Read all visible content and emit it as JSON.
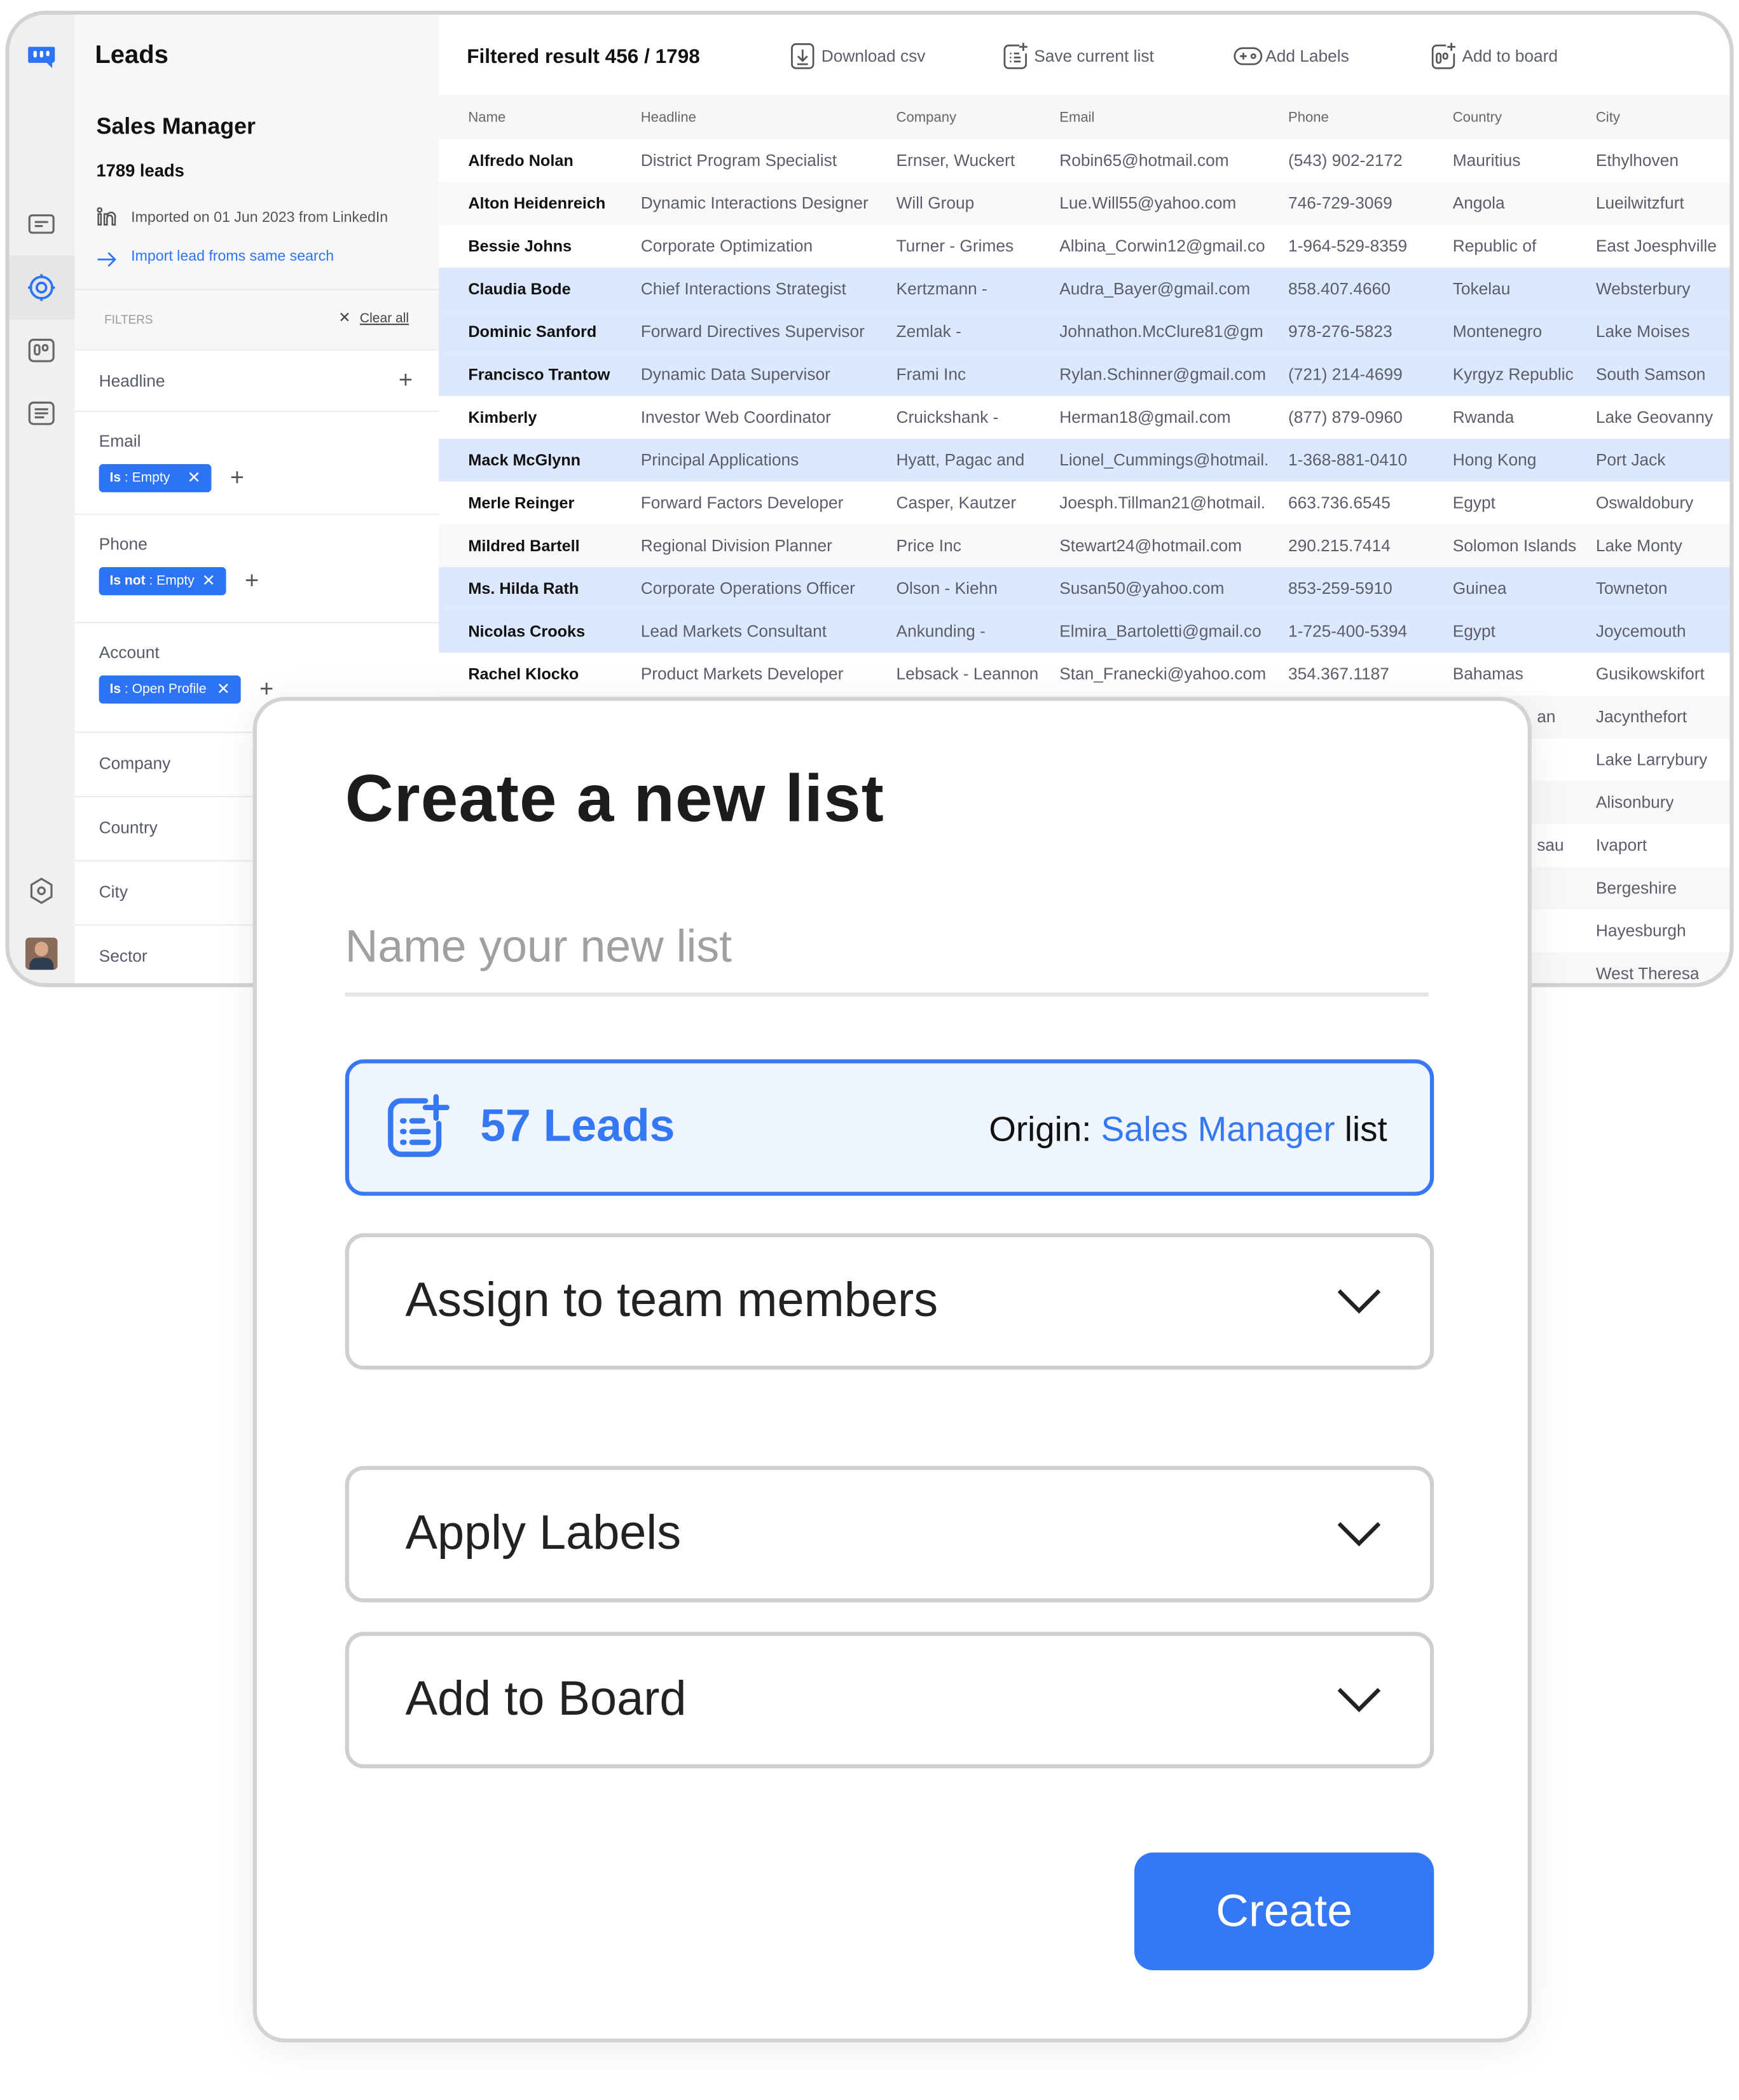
{
  "colors": {
    "accent": "#3578f6",
    "selected_row": "#dce8fd",
    "chip": "#2c74f5"
  },
  "rail": {
    "icons": [
      "logo-icon",
      "chat-icon",
      "target-icon",
      "board-icon",
      "list-icon",
      "settings-icon",
      "avatar"
    ]
  },
  "panel": {
    "title": "Leads",
    "list_name": "Sales Manager",
    "lead_count": "1789 leads",
    "imported": "Imported on 01 Jun 2023 from LinkedIn",
    "import_link": "Import lead froms same search",
    "filters_label": "FILTERS",
    "clear_all": "Clear all",
    "filters": [
      {
        "label": "Headline"
      },
      {
        "label": "Email",
        "chip_op": "Is",
        "chip_val": " : Empty"
      },
      {
        "label": "Phone",
        "chip_op": "Is not",
        "chip_val": " : Empty"
      },
      {
        "label": "Account",
        "chip_op": "Is",
        "chip_val": " : Open Profile"
      },
      {
        "label": "Company"
      },
      {
        "label": "Country"
      },
      {
        "label": "City"
      },
      {
        "label": "Sector"
      }
    ]
  },
  "toolbar": {
    "result": "Filtered result 456 / 1798",
    "download": "Download csv",
    "save": "Save current list",
    "labels": "Add Labels",
    "board": "Add to board"
  },
  "table": {
    "columns": [
      "Name",
      "Headline",
      "Company",
      "Email",
      "Phone",
      "Country",
      "City"
    ],
    "rows": [
      {
        "selected": false,
        "cells": [
          "Alfredo Nolan",
          "District Program Specialist",
          "Ernser, Wuckert",
          "Robin65@hotmail.com",
          "(543) 902-2172",
          "Mauritius",
          "Ethylhoven"
        ]
      },
      {
        "selected": false,
        "cells": [
          "Alton Heidenreich",
          "Dynamic Interactions Designer",
          "Will Group",
          "Lue.Will55@yahoo.com",
          "746-729-3069",
          "Angola",
          "Lueilwitzfurt"
        ]
      },
      {
        "selected": false,
        "cells": [
          "Bessie Johns",
          "Corporate Optimization",
          "Turner - Grimes",
          "Albina_Corwin12@gmail.co",
          "1-964-529-8359",
          "Republic of",
          "East Joesphville"
        ]
      },
      {
        "selected": true,
        "cells": [
          "Claudia Bode",
          "Chief Interactions Strategist",
          "Kertzmann -",
          "Audra_Bayer@gmail.com",
          "858.407.4660",
          "Tokelau",
          "Websterbury"
        ]
      },
      {
        "selected": true,
        "cells": [
          "Dominic Sanford",
          "Forward Directives Supervisor",
          "Zemlak -",
          "Johnathon.McClure81@gm",
          "978-276-5823",
          "Montenegro",
          "Lake Moises"
        ]
      },
      {
        "selected": true,
        "cells": [
          "Francisco Trantow",
          "Dynamic Data Supervisor",
          "Frami Inc",
          "Rylan.Schinner@gmail.com",
          "(721) 214-4699",
          "Kyrgyz Republic",
          "South Samson"
        ]
      },
      {
        "selected": false,
        "cells": [
          "Kimberly",
          "Investor Web Coordinator",
          "Cruickshank -",
          "Herman18@gmail.com",
          "(877) 879-0960",
          "Rwanda",
          "Lake Geovanny"
        ]
      },
      {
        "selected": true,
        "cells": [
          "Mack McGlynn",
          "Principal Applications",
          "Hyatt, Pagac and",
          "Lionel_Cummings@hotmail.",
          "1-368-881-0410",
          "Hong Kong",
          "Port Jack"
        ]
      },
      {
        "selected": false,
        "cells": [
          "Merle Reinger",
          "Forward Factors Developer",
          "Casper, Kautzer",
          "Joesph.Tillman21@hotmail.",
          "663.736.6545",
          "Egypt",
          "Oswaldobury"
        ]
      },
      {
        "selected": false,
        "cells": [
          "Mildred Bartell",
          "Regional Division Planner",
          "Price Inc",
          "Stewart24@hotmail.com",
          "290.215.7414",
          "Solomon Islands",
          "Lake Monty"
        ]
      },
      {
        "selected": true,
        "cells": [
          "Ms. Hilda Rath",
          "Corporate Operations Officer",
          "Olson - Kiehn",
          "Susan50@yahoo.com",
          "853-259-5910",
          "Guinea",
          "Towneton"
        ]
      },
      {
        "selected": true,
        "cells": [
          "Nicolas Crooks",
          "Lead Markets Consultant",
          "Ankunding -",
          "Elmira_Bartoletti@gmail.co",
          "1-725-400-5394",
          "Egypt",
          "Joycemouth"
        ]
      },
      {
        "selected": false,
        "cells": [
          "Rachel Klocko",
          "Product Markets Developer",
          "Lebsack - Leannon",
          "Stan_Franecki@yahoo.com",
          "354.367.1187",
          "Bahamas",
          "Gusikowskifort"
        ]
      }
    ],
    "hidden_rows": [
      {
        "country_fragment": "an",
        "city": "Jacynthefort"
      },
      {
        "country_fragment": "",
        "city": "Lake Larrybury"
      },
      {
        "country_fragment": "",
        "city": "Alisonbury"
      },
      {
        "country_fragment": "sau",
        "city": "Ivaport"
      },
      {
        "country_fragment": "",
        "city": "Bergeshire"
      },
      {
        "country_fragment": "",
        "city": "Hayesburgh"
      },
      {
        "country_fragment": "",
        "city": "West Theresa"
      }
    ]
  },
  "modal": {
    "title": "Create a new list",
    "name_placeholder": "Name your new list",
    "name_value": "",
    "leads": "57 Leads",
    "origin_prefix": "Origin: ",
    "origin_name": "Sales Manager",
    "origin_suffix": " list",
    "assign": "Assign to team members",
    "labels": "Apply Labels",
    "board": "Add to Board",
    "create": "Create"
  }
}
